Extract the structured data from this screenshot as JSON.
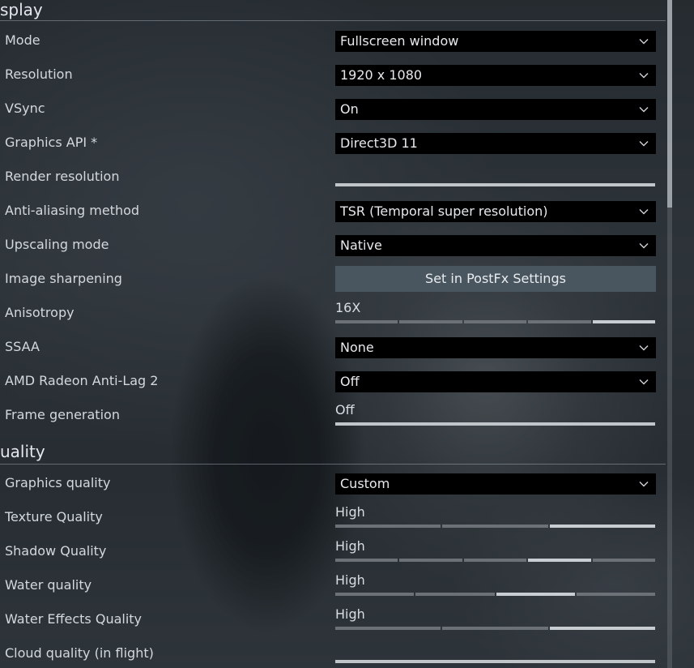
{
  "sections": {
    "display": "splay",
    "quality": "uality"
  },
  "settings": {
    "mode": {
      "label": "Mode",
      "value": "Fullscreen window"
    },
    "resolution": {
      "label": "Resolution",
      "value": "1920 x 1080"
    },
    "vsync": {
      "label": "VSync",
      "value": "On"
    },
    "graphics_api": {
      "label": "Graphics API *",
      "value": "Direct3D 11"
    },
    "render_resolution": {
      "label": "Render resolution",
      "level": 1.0
    },
    "anti_aliasing": {
      "label": "Anti-aliasing method",
      "value": "TSR (Temporal super resolution)"
    },
    "upscaling": {
      "label": "Upscaling mode",
      "value": "Native"
    },
    "image_sharpening": {
      "label": "Image sharpening",
      "button": "Set in PostFx Settings"
    },
    "anisotropy": {
      "label": "Anisotropy",
      "value": "16X",
      "step": 5,
      "steps": 5
    },
    "ssaa": {
      "label": "SSAA",
      "value": "None"
    },
    "anti_lag": {
      "label": "AMD Radeon Anti-Lag 2",
      "value": "Off"
    },
    "frame_generation": {
      "label": "Frame generation",
      "value": "Off"
    },
    "graphics_quality": {
      "label": "Graphics quality",
      "value": "Custom"
    },
    "texture_quality": {
      "label": "Texture Quality",
      "value": "High",
      "step": 3,
      "steps": 3
    },
    "shadow_quality": {
      "label": "Shadow Quality",
      "value": "High",
      "step": 4,
      "steps": 5
    },
    "water_quality": {
      "label": "Water quality",
      "value": "High",
      "step": 3,
      "steps": 4
    },
    "water_effects_quality": {
      "label": "Water Effects Quality",
      "value": "High",
      "step": 3,
      "steps": 3
    },
    "cloud_quality": {
      "label": "Cloud quality (in flight)",
      "level": 1.0
    }
  },
  "colors": {
    "dropdown_bg": "#000000",
    "button_bg": "#4a565f",
    "slider_active": "#c8cdd1",
    "slider_inactive": "#6b7176"
  },
  "icons": {
    "dropdown": "chevron-down-icon"
  }
}
